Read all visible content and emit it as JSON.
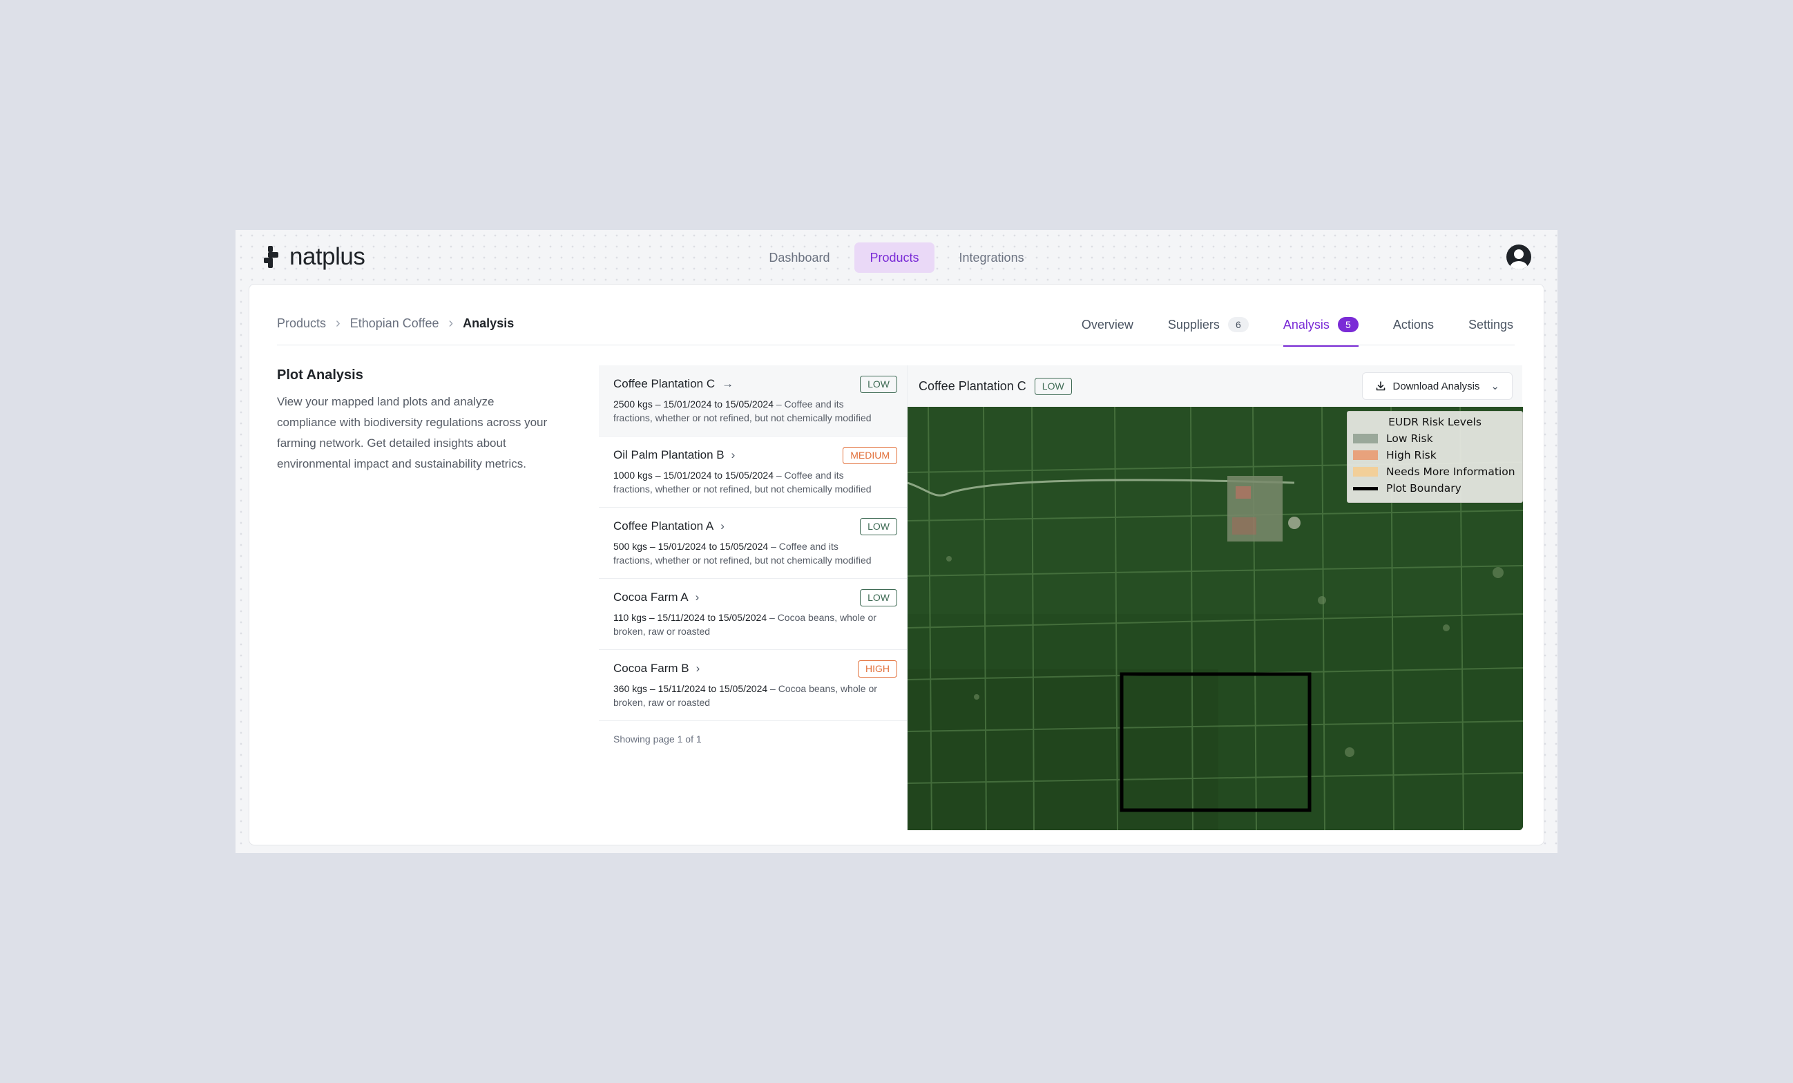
{
  "brand": {
    "name": "natplus"
  },
  "nav": {
    "items": [
      {
        "label": "Dashboard",
        "active": false
      },
      {
        "label": "Products",
        "active": true
      },
      {
        "label": "Integrations",
        "active": false
      }
    ]
  },
  "breadcrumb": [
    "Products",
    "Ethopian Coffee",
    "Analysis"
  ],
  "tabs": [
    {
      "label": "Overview"
    },
    {
      "label": "Suppliers",
      "count": "6"
    },
    {
      "label": "Analysis",
      "count": "5",
      "active": true
    },
    {
      "label": "Actions"
    },
    {
      "label": "Settings"
    }
  ],
  "intro": {
    "title": "Plot Analysis",
    "description": "View your mapped land plots and analyze compliance with biodiversity regulations across your farming network. Get detailed insights about environmental impact and sustainability metrics."
  },
  "plots": [
    {
      "name": "Coffee Plantation C",
      "risk": "LOW",
      "summary": "2500 kgs – 15/01/2024 to 15/05/2024",
      "product": " – Coffee and its fractions, whether or not refined, but not chemically modified"
    },
    {
      "name": "Oil Palm Plantation B",
      "risk": "MEDIUM",
      "summary": "1000 kgs – 15/01/2024 to 15/05/2024",
      "product": " – Coffee and its fractions, whether or not refined, but not chemically modified"
    },
    {
      "name": "Coffee Plantation A",
      "risk": "LOW",
      "summary": "500 kgs – 15/01/2024 to 15/05/2024",
      "product": " – Coffee and its fractions, whether or not refined, but not chemically modified"
    },
    {
      "name": "Cocoa Farm A",
      "risk": "LOW",
      "summary": "110 kgs – 15/11/2024 to 15/05/2024",
      "product": " – Cocoa beans, whole or broken, raw or roasted"
    },
    {
      "name": "Cocoa Farm B",
      "risk": "HIGH",
      "summary": "360 kgs – 15/11/2024 to 15/05/2024",
      "product": " – Cocoa beans, whole or broken, raw or roasted"
    }
  ],
  "pagination": {
    "text": "Showing page 1 of 1"
  },
  "detail": {
    "title": "Coffee Plantation C",
    "risk": "LOW",
    "download_label": "Download Analysis"
  },
  "legend": {
    "title": "EUDR Risk Levels",
    "items": [
      {
        "label": "Low Risk",
        "color": "#9aa89a"
      },
      {
        "label": "High Risk",
        "color": "#e8a27c"
      },
      {
        "label": "Needs More Information",
        "color": "#f2cf99"
      },
      {
        "label": "Plot Boundary",
        "color": "#000000"
      }
    ]
  },
  "colors": {
    "accent": "#7a2bd6",
    "low": "#3f6b55",
    "warn": "#e2703a"
  },
  "icons": {
    "chevron": "chevron-right-icon",
    "download": "download-icon",
    "dropdown": "chevron-down-icon"
  }
}
